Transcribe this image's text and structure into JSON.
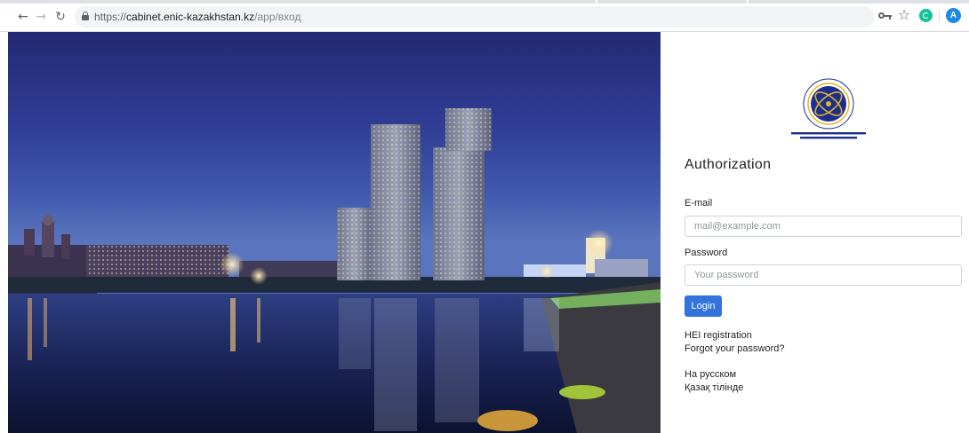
{
  "browser": {
    "url_scheme": "https://",
    "url_host": "cabinet.enic-kazakhstan.kz",
    "url_path": "/app/вход",
    "avatar_letter": "A",
    "icons": {
      "back": "arrow-left-icon",
      "forward": "arrow-right-icon",
      "reload": "reload-icon",
      "lock": "lock-icon",
      "key": "key-icon",
      "bookmark": "star-icon",
      "extension": "grammarly-extension-icon"
    }
  },
  "login": {
    "title": "Authorization",
    "email_label": "E-mail",
    "email_placeholder": "mail@example.com",
    "email_value": "",
    "password_label": "Password",
    "password_placeholder": "Your password",
    "password_value": "",
    "login_button": "Login",
    "links": {
      "hei_registration": "HEI registration",
      "forgot_password": "Forgot your password?",
      "lang_russian": "На русском",
      "lang_kazakh": "Қазақ тілінде"
    }
  },
  "colors": {
    "primary_button": "#3273dc",
    "logo_blue": "#1d2f8c",
    "logo_gold": "#e3b62a"
  }
}
